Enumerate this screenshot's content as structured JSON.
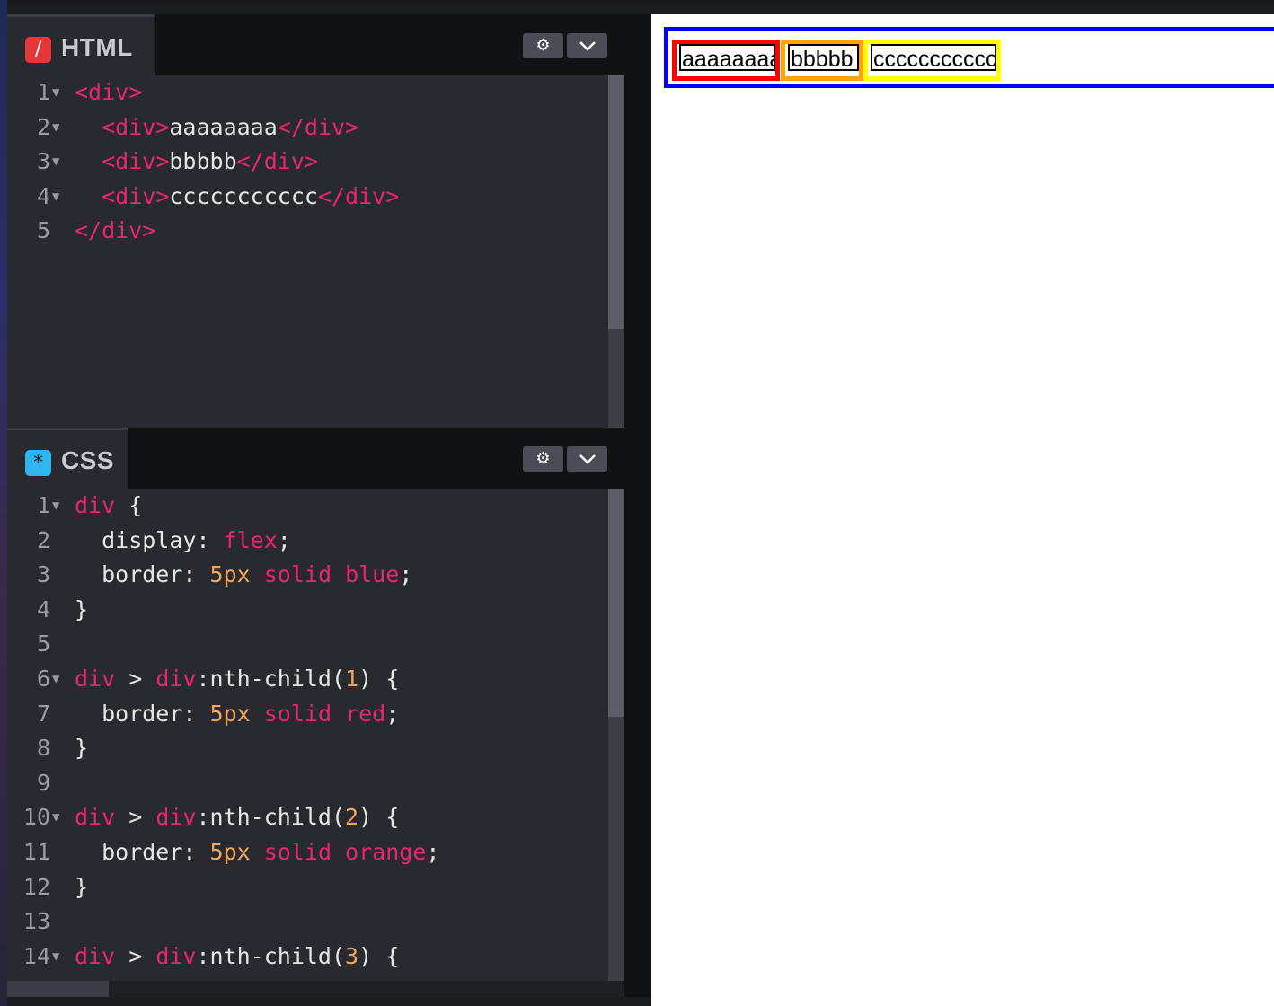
{
  "html_editor": {
    "tab_label": "HTML",
    "tab_icon": "slash-icon",
    "lines": [
      {
        "n": "1",
        "fold": true,
        "tokens": [
          {
            "t": "<div>",
            "c": "tag"
          }
        ]
      },
      {
        "n": "2",
        "fold": true,
        "tokens": [
          {
            "t": "  "
          },
          {
            "t": "<div>",
            "c": "tag"
          },
          {
            "t": "aaaaaaaa"
          },
          {
            "t": "</div>",
            "c": "tag"
          }
        ]
      },
      {
        "n": "3",
        "fold": true,
        "tokens": [
          {
            "t": "  "
          },
          {
            "t": "<div>",
            "c": "tag"
          },
          {
            "t": "bbbbb"
          },
          {
            "t": "</div>",
            "c": "tag"
          }
        ]
      },
      {
        "n": "4",
        "fold": true,
        "tokens": [
          {
            "t": "  "
          },
          {
            "t": "<div>",
            "c": "tag"
          },
          {
            "t": "ccccccccccc"
          },
          {
            "t": "</div>",
            "c": "tag"
          }
        ]
      },
      {
        "n": "5",
        "fold": false,
        "tokens": [
          {
            "t": "</div>",
            "c": "tag"
          }
        ]
      }
    ]
  },
  "css_editor": {
    "tab_label": "CSS",
    "tab_icon": "asterisk-icon",
    "lines": [
      {
        "n": "1",
        "fold": true,
        "tokens": [
          {
            "t": "div",
            "c": "sel"
          },
          {
            "t": " {"
          }
        ]
      },
      {
        "n": "2",
        "fold": false,
        "tokens": [
          {
            "t": "  display: "
          },
          {
            "t": "flex",
            "c": "val"
          },
          {
            "t": ";"
          }
        ]
      },
      {
        "n": "3",
        "fold": false,
        "tokens": [
          {
            "t": "  border: "
          },
          {
            "t": "5px",
            "c": "num"
          },
          {
            "t": " "
          },
          {
            "t": "solid",
            "c": "val"
          },
          {
            "t": " "
          },
          {
            "t": "blue",
            "c": "val"
          },
          {
            "t": ";"
          }
        ]
      },
      {
        "n": "4",
        "fold": false,
        "tokens": [
          {
            "t": "}"
          }
        ]
      },
      {
        "n": "5",
        "fold": false,
        "tokens": []
      },
      {
        "n": "6",
        "fold": true,
        "tokens": [
          {
            "t": "div",
            "c": "sel"
          },
          {
            "t": " > "
          },
          {
            "t": "div",
            "c": "sel"
          },
          {
            "t": ":nth-child("
          },
          {
            "t": "1",
            "c": "num"
          },
          {
            "t": ") {"
          }
        ]
      },
      {
        "n": "7",
        "fold": false,
        "tokens": [
          {
            "t": "  border: "
          },
          {
            "t": "5px",
            "c": "num"
          },
          {
            "t": " "
          },
          {
            "t": "solid",
            "c": "val"
          },
          {
            "t": " "
          },
          {
            "t": "red",
            "c": "val"
          },
          {
            "t": ";"
          }
        ]
      },
      {
        "n": "8",
        "fold": false,
        "tokens": [
          {
            "t": "}"
          }
        ]
      },
      {
        "n": "9",
        "fold": false,
        "tokens": []
      },
      {
        "n": "10",
        "fold": true,
        "tokens": [
          {
            "t": "div",
            "c": "sel"
          },
          {
            "t": " > "
          },
          {
            "t": "div",
            "c": "sel"
          },
          {
            "t": ":nth-child("
          },
          {
            "t": "2",
            "c": "num"
          },
          {
            "t": ") {"
          }
        ]
      },
      {
        "n": "11",
        "fold": false,
        "tokens": [
          {
            "t": "  border: "
          },
          {
            "t": "5px",
            "c": "num"
          },
          {
            "t": " "
          },
          {
            "t": "solid",
            "c": "val"
          },
          {
            "t": " "
          },
          {
            "t": "orange",
            "c": "val"
          },
          {
            "t": ";"
          }
        ]
      },
      {
        "n": "12",
        "fold": false,
        "tokens": [
          {
            "t": "}"
          }
        ]
      },
      {
        "n": "13",
        "fold": false,
        "tokens": []
      },
      {
        "n": "14",
        "fold": true,
        "tokens": [
          {
            "t": "div",
            "c": "sel"
          },
          {
            "t": " > "
          },
          {
            "t": "div",
            "c": "sel"
          },
          {
            "t": ":nth-child("
          },
          {
            "t": "3",
            "c": "num"
          },
          {
            "t": ") {"
          }
        ]
      }
    ]
  },
  "header_buttons": {
    "settings_icon": "gear-icon",
    "collapse_icon": "chevron-down-icon"
  },
  "preview": {
    "items": [
      "aaaaaaaa",
      "bbbbb",
      "ccccccccccc"
    ],
    "colors": {
      "outer_border": "#0000ff",
      "item_borders": [
        "#ff0000",
        "#ffa500",
        "#ffff00"
      ]
    }
  }
}
